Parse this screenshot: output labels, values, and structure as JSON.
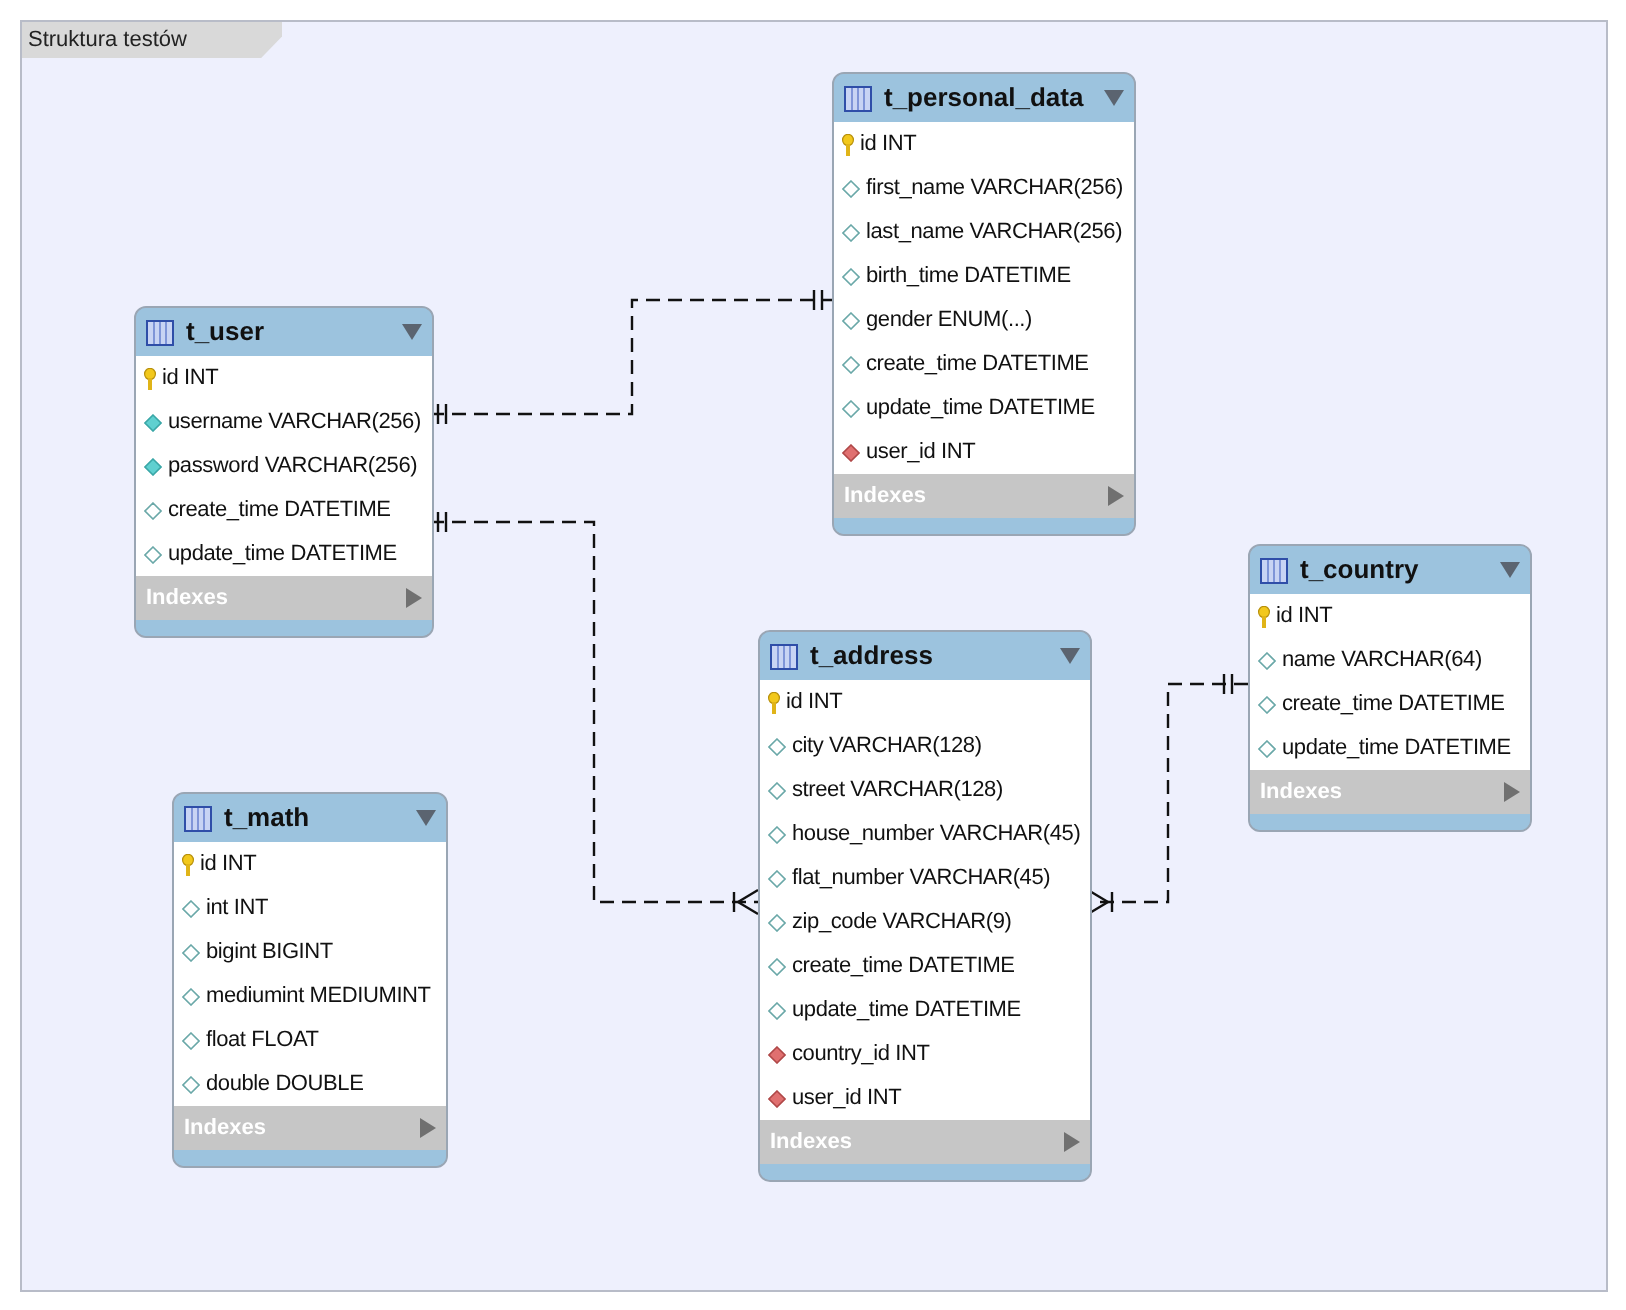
{
  "canvas": {
    "tab_label": "Struktura testów"
  },
  "tables": [
    {
      "name": "t_personal_data",
      "indexes_label": "Indexes",
      "columns": [
        {
          "text": "id INT",
          "kind": "primary"
        },
        {
          "text": "first_name VARCHAR(256)",
          "kind": "nullable"
        },
        {
          "text": "last_name VARCHAR(256)",
          "kind": "nullable"
        },
        {
          "text": "birth_time DATETIME",
          "kind": "nullable"
        },
        {
          "text": "gender ENUM(...)",
          "kind": "nullable"
        },
        {
          "text": "create_time DATETIME",
          "kind": "nullable"
        },
        {
          "text": "update_time DATETIME",
          "kind": "nullable"
        },
        {
          "text": "user_id INT",
          "kind": "foreign"
        }
      ]
    },
    {
      "name": "t_user",
      "indexes_label": "Indexes",
      "columns": [
        {
          "text": "id INT",
          "kind": "primary"
        },
        {
          "text": "username VARCHAR(256)",
          "kind": "not_null"
        },
        {
          "text": "password VARCHAR(256)",
          "kind": "not_null"
        },
        {
          "text": "create_time DATETIME",
          "kind": "nullable"
        },
        {
          "text": "update_time DATETIME",
          "kind": "nullable"
        }
      ]
    },
    {
      "name": "t_country",
      "indexes_label": "Indexes",
      "columns": [
        {
          "text": "id INT",
          "kind": "primary"
        },
        {
          "text": "name VARCHAR(64)",
          "kind": "nullable"
        },
        {
          "text": "create_time DATETIME",
          "kind": "nullable"
        },
        {
          "text": "update_time DATETIME",
          "kind": "nullable"
        }
      ]
    },
    {
      "name": "t_address",
      "indexes_label": "Indexes",
      "columns": [
        {
          "text": "id INT",
          "kind": "primary"
        },
        {
          "text": "city VARCHAR(128)",
          "kind": "nullable"
        },
        {
          "text": "street VARCHAR(128)",
          "kind": "nullable"
        },
        {
          "text": "house_number VARCHAR(45)",
          "kind": "nullable"
        },
        {
          "text": "flat_number VARCHAR(45)",
          "kind": "nullable"
        },
        {
          "text": "zip_code VARCHAR(9)",
          "kind": "nullable"
        },
        {
          "text": "create_time DATETIME",
          "kind": "nullable"
        },
        {
          "text": "update_time DATETIME",
          "kind": "nullable"
        },
        {
          "text": "country_id INT",
          "kind": "foreign"
        },
        {
          "text": "user_id INT",
          "kind": "foreign"
        }
      ]
    },
    {
      "name": "t_math",
      "indexes_label": "Indexes",
      "columns": [
        {
          "text": "id INT",
          "kind": "primary"
        },
        {
          "text": "int INT",
          "kind": "nullable"
        },
        {
          "text": "bigint BIGINT",
          "kind": "nullable"
        },
        {
          "text": "mediumint MEDIUMINT",
          "kind": "nullable"
        },
        {
          "text": "float FLOAT",
          "kind": "nullable"
        },
        {
          "text": "double DOUBLE",
          "kind": "nullable"
        }
      ]
    }
  ]
}
